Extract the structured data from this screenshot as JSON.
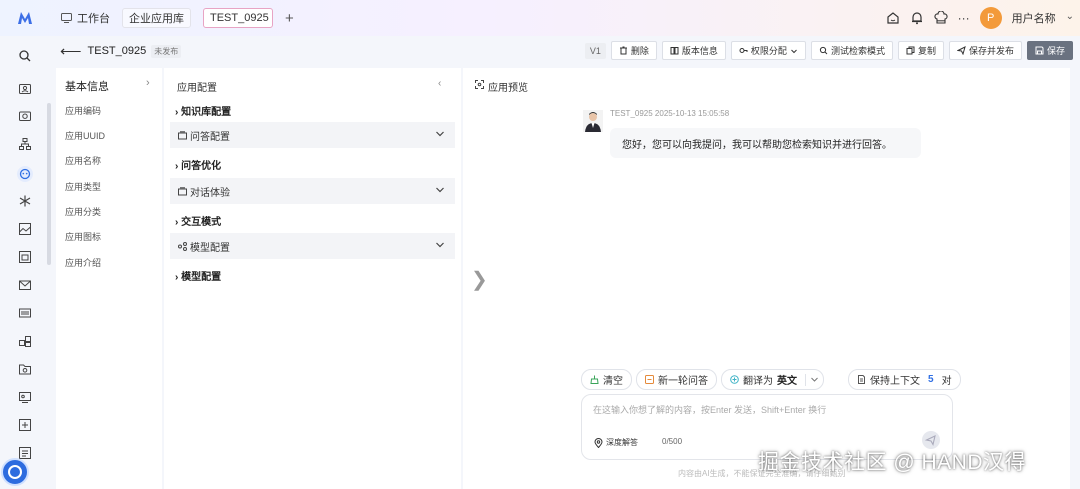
{
  "top_nav": {
    "workspace_label": "工作台",
    "app_library_label": "企业应用库",
    "active_tab_label": "TEST_0925",
    "add_tab_label": "+",
    "more_label": "···",
    "avatar_initial": "P",
    "username": "用户名称",
    "username_chevron": "⌄"
  },
  "header": {
    "back_label": "⟵",
    "app_name": "TEST_0925",
    "status": "未发布",
    "version": "V1",
    "actions": {
      "delete": "删除",
      "version_info": "版本信息",
      "permission": "权限分配",
      "test_search": "测试检索模式",
      "copy": "复制",
      "save_publish": "保存并发布",
      "save": "保存"
    }
  },
  "basic_info": {
    "title": "基本信息",
    "chevron": "›",
    "items": [
      "应用编码",
      "应用UUID",
      "应用名称",
      "应用类型",
      "应用分类",
      "应用图标",
      "应用介绍"
    ]
  },
  "config": {
    "title": "应用配置",
    "collapse_label": "‹",
    "knowledge_section": "› 知识库配置",
    "qa_config": "问答配置",
    "qa_optimize": "› 问答优化",
    "dialog_exp": "对话体验",
    "interaction_mode": "› 交互模式",
    "model_config_group": "模型配置",
    "model_config_section": "› 模型配置"
  },
  "preview": {
    "title": "应用预览",
    "side_toggle": "❯",
    "message_meta": "TEST_0925 2025-10-13 15:05:58",
    "message_text": "您好，您可以向我提问，我可以帮助您检索知识并进行回答。",
    "chips": {
      "clear": "清空",
      "new_round": "新一轮问答",
      "translate_prefix": "翻译为",
      "translate_lang": "英文",
      "context_prefix": "保持上下文",
      "context_count": "5",
      "context_suffix": "对"
    },
    "input_placeholder": "在这输入你想了解的内容，按Enter 发送，Shift+Enter 换行",
    "input_value": "",
    "deep_answer": "深度解答",
    "char_count": "0/500",
    "disclaimer": "内容由AI生成，不能保证完全准确，请仔细甄别"
  },
  "watermark": "掘金技术社区 @ HAND汉得",
  "colors": {
    "accent": "#2f6fe4",
    "avatar": "#f39a3a",
    "save_button": "#6a7280"
  }
}
